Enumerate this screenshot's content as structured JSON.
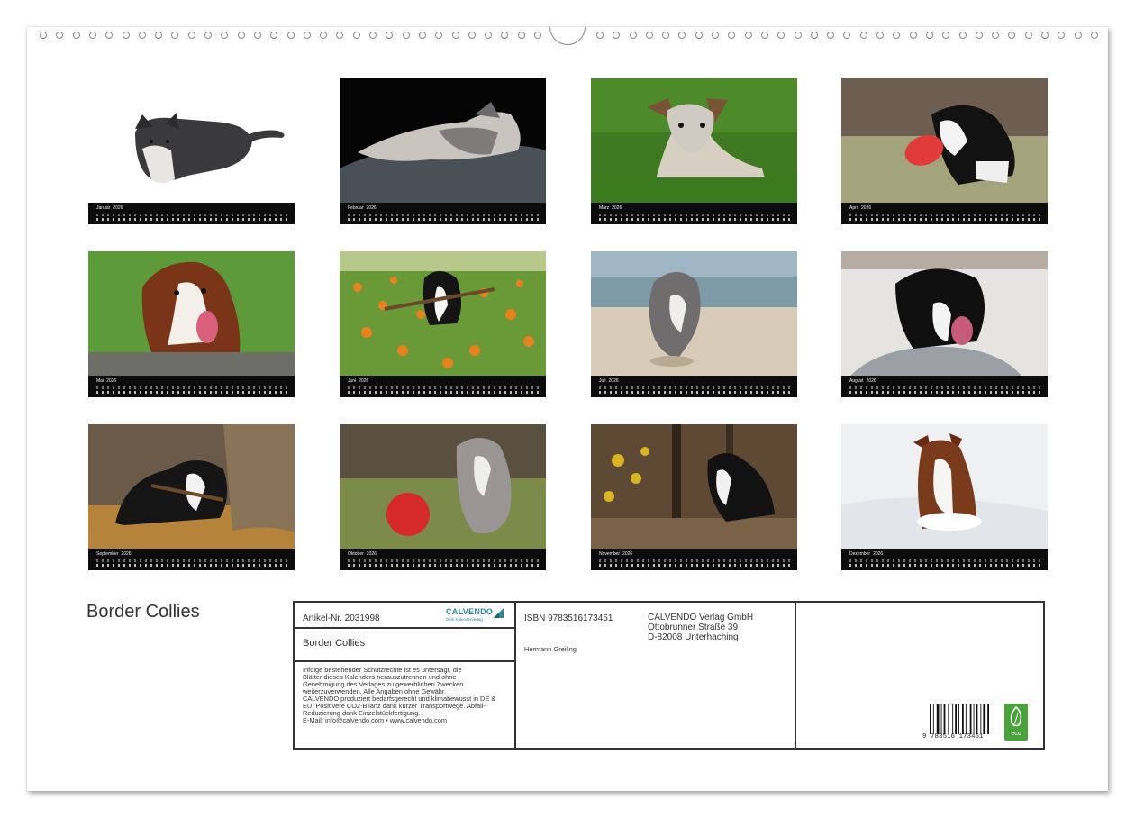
{
  "calendar": {
    "title": "Border Collies",
    "year": "2026",
    "months": [
      "Januar",
      "Februar",
      "März",
      "April",
      "Mai",
      "Juni",
      "Juli",
      "August",
      "September",
      "Oktober",
      "November",
      "Dezember"
    ]
  },
  "imprint": {
    "article_label": "Artikel-Nr. 2031998",
    "publisher_logo": "CALVENDO",
    "publisher_tagline": "Dein Kalenderverlag",
    "product_title": "Border Collies",
    "notice_lines": [
      "Infolge bestehender Schutzrechte ist es untersagt, die",
      "Blätter dieses Kalenders herauszutrennen und ohne",
      "Genehmigung des Verlages zu gewerblichen Zwecken",
      "weiterzuverwenden. Alle Angaben ohne Gewähr.",
      "CALVENDO produziert bedarfsgerecht und klimabewusst in DE &",
      "EU. Positivere CO2-Bilanz dank kurzer Transportwege. Abfall-",
      "Reduzierung dank Einzelstückfertigung.",
      "E-Mail: info@calvendo.com • www.calvendo.com"
    ],
    "isbn": "ISBN 9783516173451",
    "author": "Hermann Greiling",
    "address_lines": [
      "CALVENDO Verlag GmbH",
      "Ottobrunner Straße 39",
      "D-82008 Unterhaching"
    ],
    "barcode_number": "9 783516 173451",
    "eco_label": "eco"
  },
  "colors": {
    "band": "#0c0c0c",
    "frame": "#333333",
    "logo": "#2a8a9a",
    "eco": "#4aa33a"
  }
}
